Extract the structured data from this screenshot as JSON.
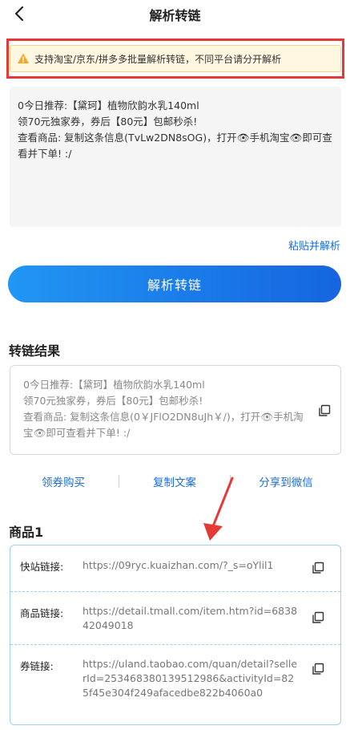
{
  "header": {
    "title": "解析转链"
  },
  "notice": {
    "text": "支持淘宝/京东/拼多多批量解析转链，不同平台请分开解析"
  },
  "input": {
    "value": "0今日推荐:【黛珂】植物欣韵水乳140ml\n领70元独家券，券后【80元】包邮秒杀!\n查看商品: 复制这条信息(TvLw2DN8sOG)，打开👁手机淘宝👁即可查看并下单! :/"
  },
  "paste_label": "粘贴并解析",
  "parse_button": "解析转链",
  "result": {
    "title": "转链结果",
    "text": "0今日推荐:【黛珂】植物欣韵水乳140ml\n领70元独家券，券后【80元】包邮秒杀!\n查看商品: 复制这条信息(0￥JFlO2DN8uJh￥/)，打开👁手机淘宝👁即可查看并下单! :/"
  },
  "actions": {
    "buy": "领券购买",
    "copy": "复制文案",
    "share": "分享到微信"
  },
  "goods": {
    "title": "商品1",
    "rows": [
      {
        "label": "快站链接:",
        "value": "https://09ryc.kuaizhan.com/?_s=oYlil1"
      },
      {
        "label": "商品链接:",
        "value": "https://detail.tmall.com/item.htm?id=683842049018"
      },
      {
        "label": "券链接:",
        "value": "https://uland.taobao.com/quan/detail?sellerId=2534683801395129​86&activityId=825f45e304f249afacedbe822b4060a0"
      }
    ]
  },
  "colors": {
    "accent": "#1a6ed8",
    "button_gradient_start": "#2196f3",
    "button_gradient_end": "#1565e0",
    "highlight_red": "#e53935",
    "notice_bg": "#fff7e0",
    "goods_border": "#9ad3ea"
  },
  "icons": {
    "back": "chevron-left-icon",
    "warning": "warning-triangle-icon",
    "copy": "copy-icon",
    "annotation": "red-arrow-annotation"
  }
}
